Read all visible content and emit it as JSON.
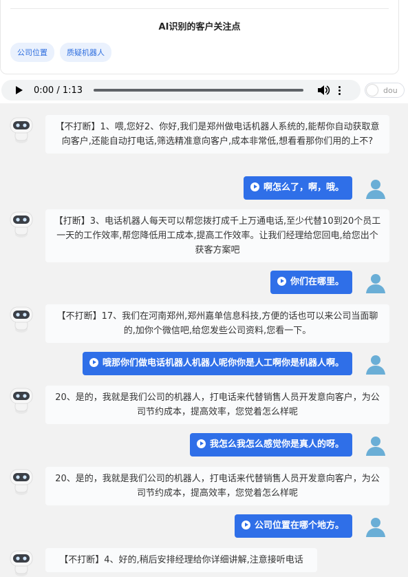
{
  "panel": {
    "title": "AI识别的客户关注点",
    "tags": [
      "公司位置",
      "质疑机器人"
    ]
  },
  "audio": {
    "time": "0:00 / 1:13",
    "toggle_label": "dou"
  },
  "messages": [
    {
      "role": "bot",
      "text": "【不打断】1、喂,您好2、你好,我们是郑州做电话机器人系统的,能帮你自动获取意向客户,还能自动打电话,筛选精准意向客户,成本非常低,想看看那你们用的上不?"
    },
    {
      "role": "user",
      "text": "啊怎么了，啊，哦。"
    },
    {
      "role": "bot",
      "text": "【打断】3、电话机器人每天可以帮您拨打成千上万通电话,至少代替10到20个员工一天的工作效率,帮您降低用工成本,提高工作效率。让我们经理给您回电,给您出个获客方案吧"
    },
    {
      "role": "user",
      "text": "你们在哪里。"
    },
    {
      "role": "bot",
      "text": "【不打断】17、我们在河南郑州,郑州嘉单信息科技,方便的话也可以来公司当面聊的,加你个微信吧,给您发些公司资料,您看一下。"
    },
    {
      "role": "user",
      "text": "哦那你们做电话机器人机器人呢你你是人工啊你是机器人啊。"
    },
    {
      "role": "bot",
      "text": "20、是的，我就是我们公司的机器人，打电话来代替销售人员开发意向客户，为公司节约成本，提高效率，您觉着怎么样呢"
    },
    {
      "role": "user",
      "text": "我怎么我怎么感觉你是真人的呀。"
    },
    {
      "role": "bot",
      "text": "20、是的，我就是我们公司的机器人，打电话来代替销售人员开发意向客户，为公司节约成本，提高效率，您觉着怎么样呢"
    },
    {
      "role": "user",
      "text": "公司位置在哪个地方。"
    },
    {
      "role": "bot",
      "text": "【不打断】4、好的,稍后安排经理给你详细讲解,注意接听电话"
    }
  ],
  "colors": {
    "accent": "#2f6fe8",
    "tag_bg": "#eaf1fd",
    "chat_bg": "#f2f2f2"
  }
}
